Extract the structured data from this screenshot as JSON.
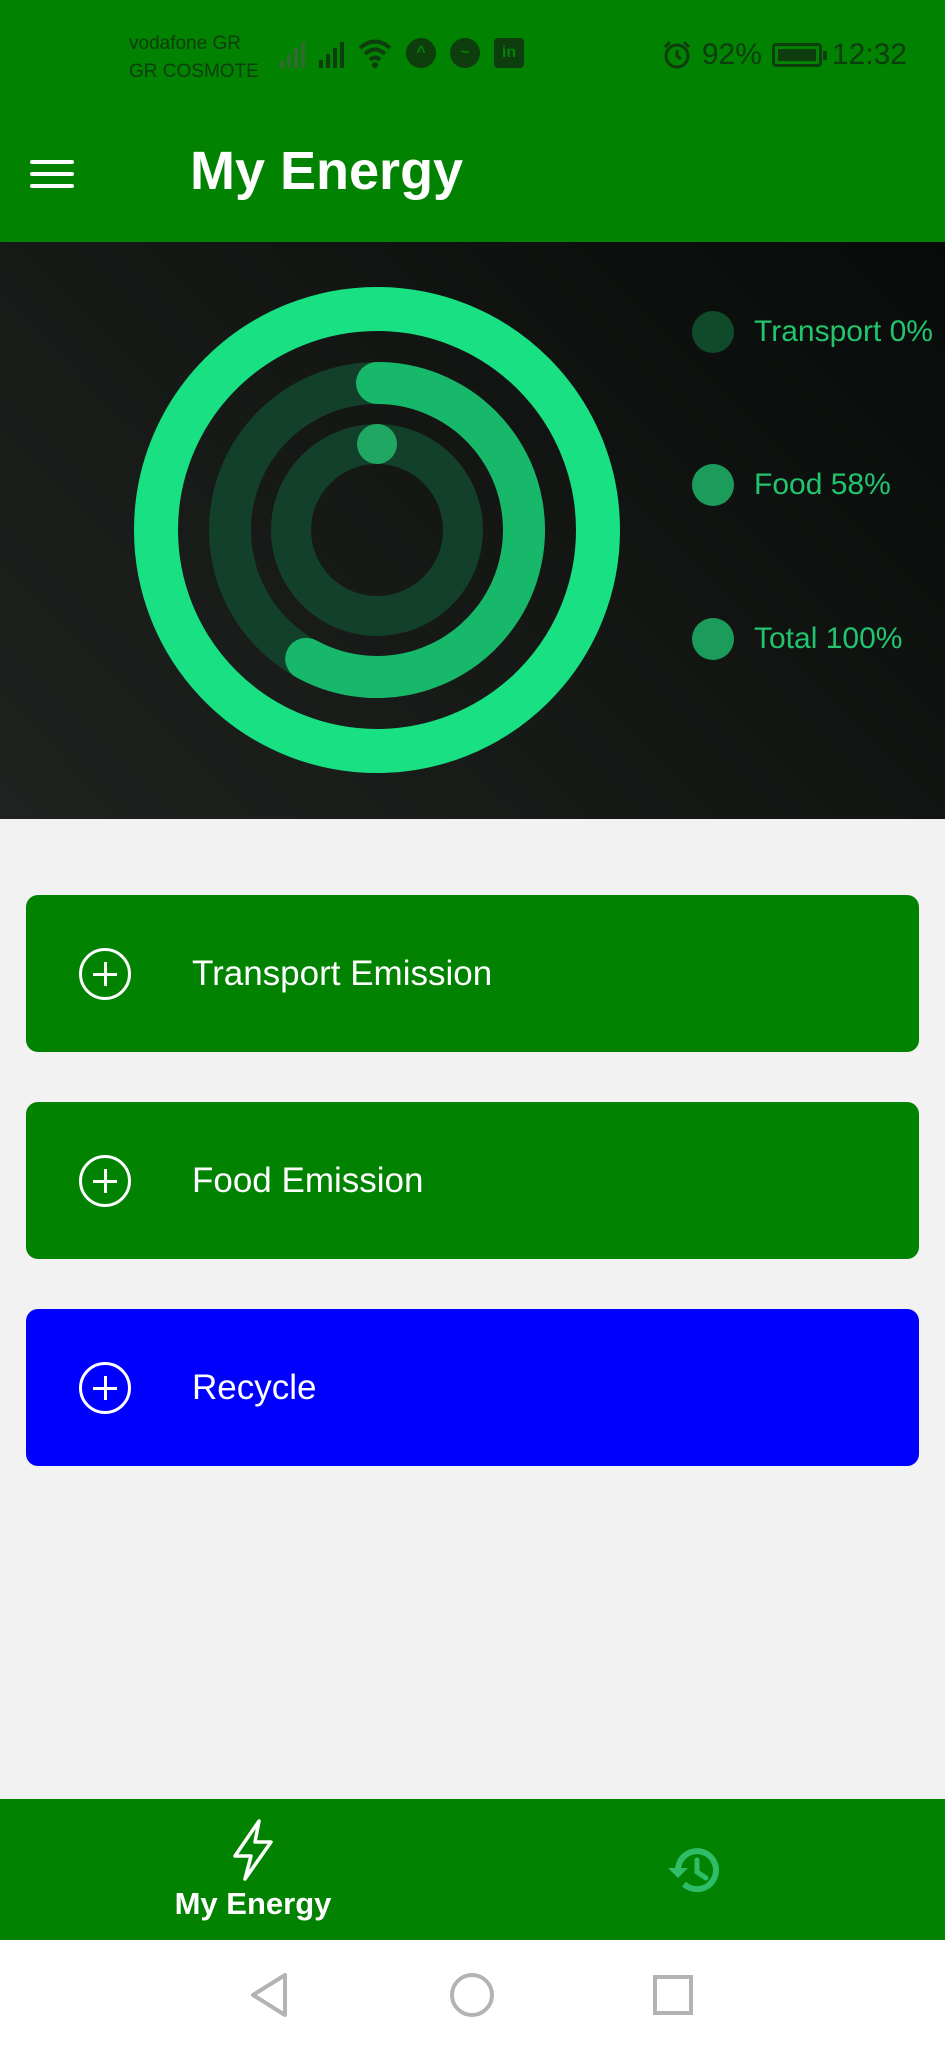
{
  "status_bar": {
    "carrier_1": "vodafone GR",
    "carrier_2": "GR COSMOTE",
    "icons": [
      "signal-icon",
      "signal-icon",
      "wifi-icon",
      "app-notification-icon",
      "messenger-icon",
      "linkedin-icon",
      "alarm-icon",
      "battery-icon"
    ],
    "battery": "92%",
    "time": "12:32"
  },
  "app_bar": {
    "menu_icon": "hamburger-menu-icon",
    "title": "My Energy"
  },
  "chart_data": {
    "type": "radial-ring",
    "series": [
      {
        "name": "Transport",
        "label": "Transport 0%",
        "value": 0,
        "color": "#0f4a2a"
      },
      {
        "name": "Food",
        "label": "Food 58%",
        "value": 58,
        "color": "#18b86a"
      },
      {
        "name": "Total",
        "label": "Total 100%",
        "value": 100,
        "color": "#19e082"
      }
    ],
    "track_color": "#12402a",
    "legend_placement": "right"
  },
  "actions": [
    {
      "label": "Transport Emission",
      "icon": "add-circle-icon",
      "color": "#018301"
    },
    {
      "label": "Food Emission",
      "icon": "add-circle-icon",
      "color": "#018301"
    },
    {
      "label": "Recycle",
      "icon": "add-circle-icon",
      "color": "#0000fe"
    }
  ],
  "bottom_nav": [
    {
      "label": "My Energy",
      "icon": "lightning-bolt-icon",
      "active": true
    },
    {
      "label": "",
      "icon": "history-icon",
      "active": false
    }
  ],
  "system_nav": [
    "back-icon",
    "home-icon",
    "recents-icon"
  ]
}
